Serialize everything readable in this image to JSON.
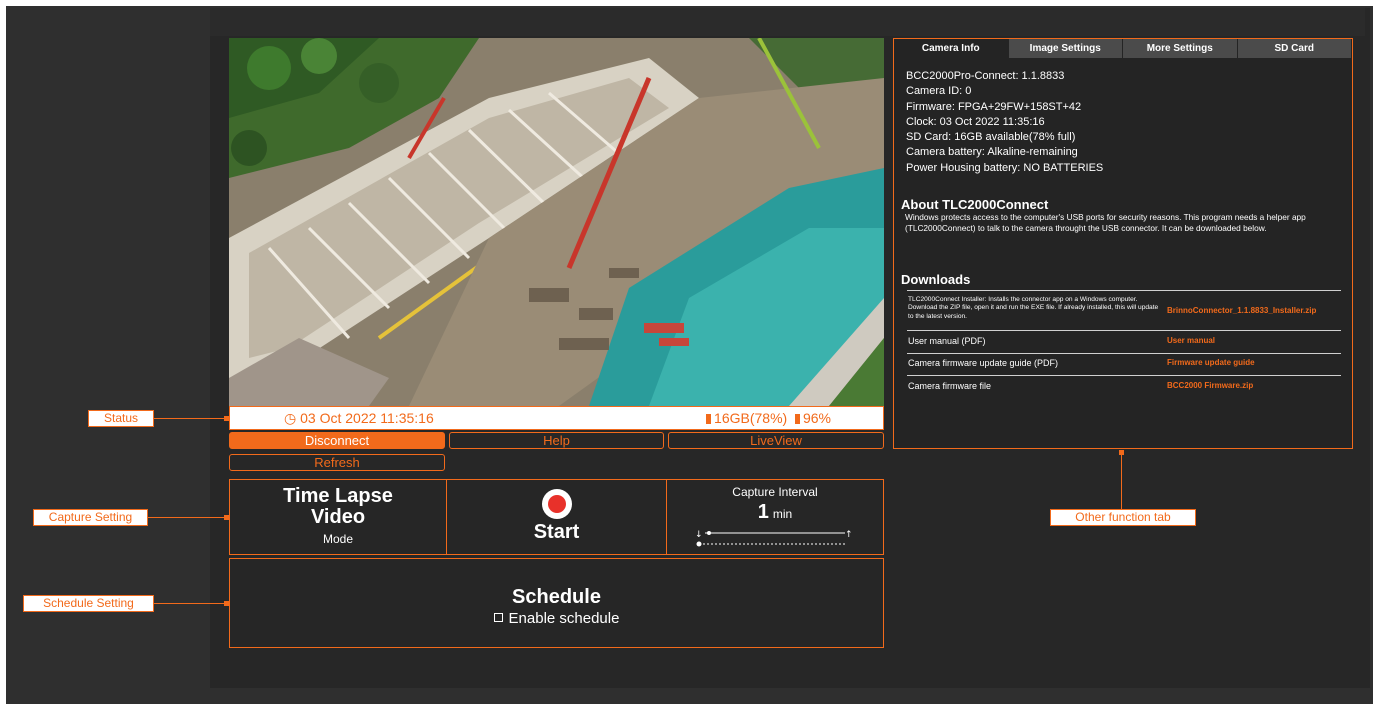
{
  "status": {
    "datetime": "03 Oct 2022 11:35:16",
    "sd": "16GB(78%)",
    "battery": "96%"
  },
  "buttons": {
    "disconnect": "Disconnect",
    "help": "Help",
    "liveview": "LiveView",
    "refresh": "Refresh"
  },
  "capture": {
    "mode_title_1": "Time Lapse",
    "mode_title_2": "Video",
    "mode_label": "Mode",
    "start_label": "Start",
    "interval_title": "Capture Interval",
    "interval_value": "1",
    "interval_unit": "min"
  },
  "schedule": {
    "title": "Schedule",
    "enable_label": "Enable schedule"
  },
  "tabs": [
    "Camera Info",
    "Image Settings",
    "More Settings",
    "SD Card"
  ],
  "camera_info": [
    "BCC2000Pro-Connect: 1.1.8833",
    "Camera ID: 0",
    "Firmware: FPGA+29FW+158ST+42",
    "Clock: 03 Oct 2022 11:35:16",
    "SD Card: 16GB available(78% full)",
    "Camera battery: Alkaline-remaining",
    "Power Housing battery: NO BATTERIES"
  ],
  "about": {
    "title": "About TLC2000Connect",
    "text": "Windows protects access to the computer's USB ports for security reasons. This program needs a helper app (TLC2000Connect) to talk to the camera throught the USB connector. It can be downloaded below."
  },
  "downloads": {
    "title": "Downloads",
    "rows": [
      {
        "desc": "TLC2000Connect Installer: Installs the connector app on a Windows computer. Download the ZIP file, open it and run the EXE file. If already installed, this will update to the latest version.",
        "link": "BrinnoConnector_1.1.8833_Installer.zip"
      },
      {
        "desc": "User manual (PDF)",
        "link": "User manual"
      },
      {
        "desc": "Camera firmware update guide (PDF)",
        "link": "Firmware update guide"
      },
      {
        "desc": "Camera firmware file",
        "link": "BCC2000 Firmware.zip"
      }
    ]
  },
  "annotations": {
    "status": "Status",
    "capture": "Capture Setting",
    "schedule": "Schedule Setting",
    "other": "Other function tab"
  },
  "colors": {
    "accent": "#f26a1b",
    "panel": "#262626",
    "record": "#e8312a"
  },
  "icons": [
    "clock-icon",
    "sd-card-icon",
    "battery-icon",
    "record-icon",
    "checkbox-icon"
  ]
}
